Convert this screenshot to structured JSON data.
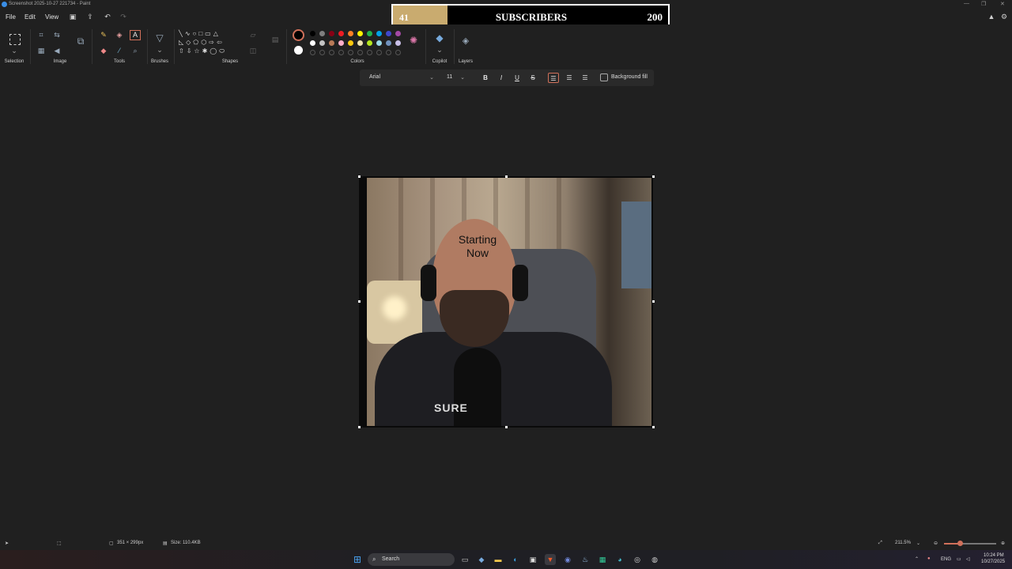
{
  "window": {
    "title": "Screenshot 2025-10-27 221734 - Paint"
  },
  "menu": {
    "file": "File",
    "edit": "Edit",
    "view": "View"
  },
  "overlay": {
    "left_count": "41",
    "label": "SUBSCRIBERS",
    "right_count": "200"
  },
  "ribbon": {
    "groups": [
      "Selection",
      "Image",
      "Tools",
      "Brushes",
      "Shapes",
      "Colors",
      "Copilot",
      "Layers"
    ]
  },
  "colors": {
    "row1": [
      "#000000",
      "#7f7f7f",
      "#880015",
      "#ed1c24",
      "#ff7f27",
      "#fff200",
      "#22b14c",
      "#00a2e8",
      "#3f48cc",
      "#a349a4"
    ],
    "row2": [
      "#ffffff",
      "#c3c3c3",
      "#b97a57",
      "#ffaec9",
      "#ffc90e",
      "#efe4b0",
      "#b5e61d",
      "#99d9ea",
      "#7092be",
      "#c8bfe7"
    ]
  },
  "text_toolbar": {
    "font": "Arial",
    "size": "11",
    "bold": "B",
    "italic": "I",
    "underline": "U",
    "strike": "S",
    "background_fill": "Background fill"
  },
  "canvas": {
    "text_line1": "Starting",
    "text_line2": "Now",
    "shirt_text": "SURE"
  },
  "status": {
    "dimensions": "351 × 299px",
    "size": "Size: 110.4KB",
    "zoom": "211.5%",
    "zoom_level_percent": 30
  },
  "taskbar": {
    "search": "Search",
    "lang": "ENG",
    "time": "10:24 PM",
    "date": "10/27/2025"
  }
}
